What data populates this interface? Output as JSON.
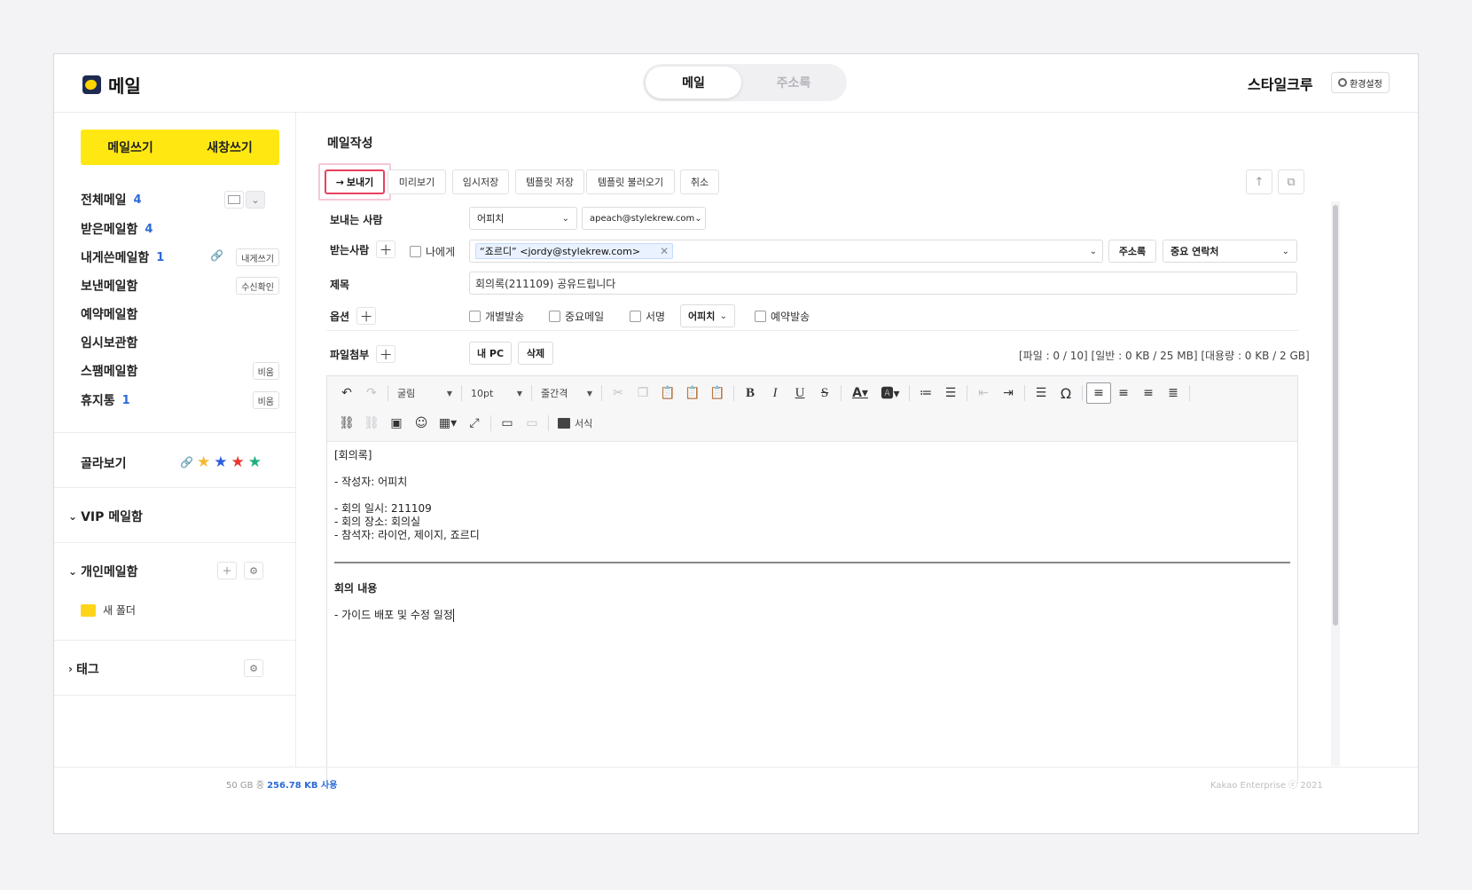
{
  "header": {
    "app_title": "메일",
    "tabs": [
      {
        "label": "메일",
        "active": true
      },
      {
        "label": "주소록",
        "active": false
      }
    ],
    "org_name": "스타일크루",
    "settings_label": "환경설정"
  },
  "sidebar": {
    "compose_label": "메일쓰기",
    "new_window_label": "새창쓰기",
    "folders": [
      {
        "label": "전체메일",
        "count": "4"
      },
      {
        "label": "받은메일함",
        "count": "4"
      },
      {
        "label": "내게쓴메일함",
        "count": "1",
        "action": "내게쓰기"
      },
      {
        "label": "보낸메일함",
        "count": "",
        "action": "수신확인"
      },
      {
        "label": "예약메일함",
        "count": ""
      },
      {
        "label": "임시보관함",
        "count": ""
      },
      {
        "label": "스팸메일함",
        "count": "",
        "action": "비움"
      },
      {
        "label": "휴지통",
        "count": "1",
        "action": "비움"
      }
    ],
    "filter_label": "골라보기",
    "vip_label": "VIP 메일함",
    "personal_label": "개인메일함",
    "new_folder_label": "새 폴더",
    "tag_label": "태그",
    "star_colors": [
      "#f5b82e",
      "#2c5fd9",
      "#e8352e",
      "#1fae80"
    ]
  },
  "compose": {
    "title": "메일작성",
    "toolbar": {
      "send": "보내기",
      "preview": "미리보기",
      "save_draft": "임시저장",
      "save_template": "템플릿 저장",
      "load_template": "템플릿 불러오기",
      "cancel": "취소"
    },
    "sender_label": "보내는 사람",
    "sender_name": "어피치",
    "sender_email": "apeach@stylekrew.com",
    "recipient_label": "받는사람",
    "to_me_label": "나에게",
    "recipient_chip": "“죠르디” <jordy@stylekrew.com>",
    "address_book_label": "주소록",
    "contact_group": "중요 연락처",
    "subject_label": "제목",
    "subject_value": "회의록(211109) 공유드립니다",
    "options_label": "옵션",
    "options": {
      "individual": "개별발송",
      "important": "중요메일",
      "signature": "서명",
      "signature_select": "어피치",
      "scheduled": "예약발송"
    },
    "attach_label": "파일첨부",
    "attach_pc": "내 PC",
    "attach_delete": "삭제",
    "attach_info": "[파일 : 0 / 10] [일반 : 0 KB / 25 MB] [대용량 : 0 KB / 2 GB]"
  },
  "editor": {
    "font_family": "굴림",
    "font_size": "10pt",
    "line_height": "줄간격",
    "format_label": "서식",
    "body": {
      "heading": "[회의록]",
      "author": "- 작성자: 어피치",
      "date": "- 회의 일시: 211109",
      "place": "- 회의 장소: 회의실",
      "attendees": "- 참석자: 라이언, 제이지, 죠르디",
      "section_title": "회의 내용",
      "content": "- 가이드 배포 및 수정 일정"
    }
  },
  "footer": {
    "usage_prefix": "50 GB 중",
    "usage_value": "256.78 KB 사용",
    "copyright": "Kakao Enterprise ⓒ 2021"
  }
}
